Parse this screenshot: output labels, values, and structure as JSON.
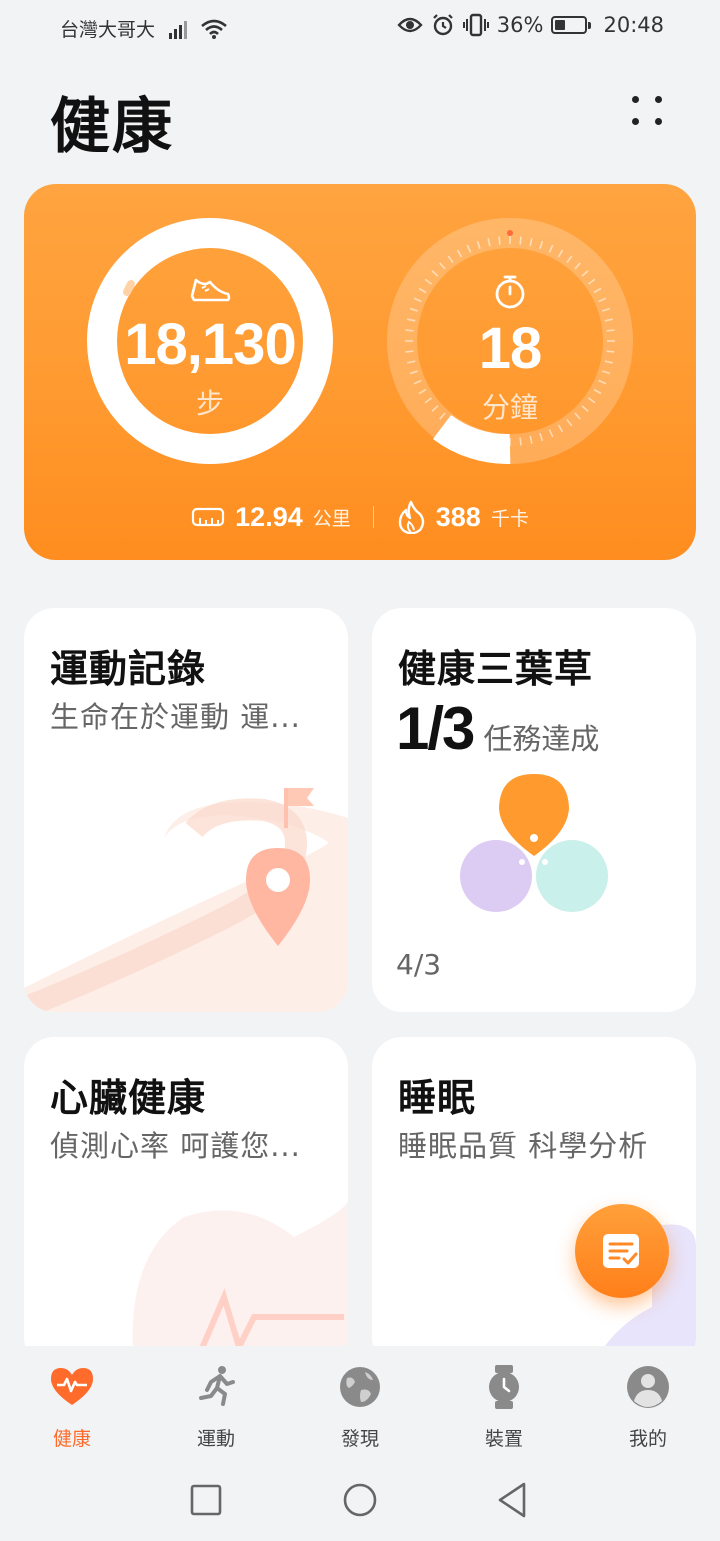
{
  "status_bar": {
    "carrier": "台灣大哥大",
    "battery_percent": "36%",
    "battery_level": 0.36,
    "time": "20:48",
    "icons": [
      "signal-icon",
      "wifi-icon",
      "eye-icon",
      "alarm-icon",
      "vibrate-icon",
      "battery-icon"
    ]
  },
  "header": {
    "title": "健康",
    "menu_icon": "more-dots-icon"
  },
  "activity": {
    "steps_value": "18,130",
    "steps_unit": "步",
    "steps_icon": "shoe-icon",
    "minutes_value": "18",
    "minutes_unit": "分鐘",
    "minutes_icon": "stopwatch-icon",
    "distance_value": "12.94",
    "distance_unit": "公里",
    "distance_icon": "ruler-icon",
    "calories_value": "388",
    "calories_unit": "千卡",
    "calories_icon": "flame-icon",
    "colors": {
      "card_top": "#ffa440",
      "card_bottom": "#ff8d1f"
    }
  },
  "cards": {
    "exercise": {
      "title": "運動記錄",
      "subtitle": "生命在於運動 運..."
    },
    "clover": {
      "title": "健康三葉草",
      "progress": "1/3",
      "progress_label": "任務達成",
      "footer": "4/3",
      "colors": {
        "activity": "#ff9a2e",
        "sleep": "#dccbf3",
        "mood": "#c9f0ea"
      }
    },
    "heart": {
      "title": "心臟健康",
      "subtitle": "偵測心率 呵護您..."
    },
    "sleep": {
      "title": "睡眠",
      "subtitle": "睡眠品質 科學分析"
    }
  },
  "fab": {
    "icon": "edit-note-icon"
  },
  "bottom_nav": {
    "items": [
      {
        "label": "健康",
        "icon": "heart-pulse-icon",
        "active": true
      },
      {
        "label": "運動",
        "icon": "running-icon",
        "active": false
      },
      {
        "label": "發現",
        "icon": "globe-icon",
        "active": false
      },
      {
        "label": "裝置",
        "icon": "watch-icon",
        "active": false
      },
      {
        "label": "我的",
        "icon": "profile-icon",
        "active": false
      }
    ],
    "active_color": "#ff6b2a"
  },
  "system_nav": {
    "buttons": [
      "recent-apps-icon",
      "home-icon",
      "back-icon"
    ]
  }
}
